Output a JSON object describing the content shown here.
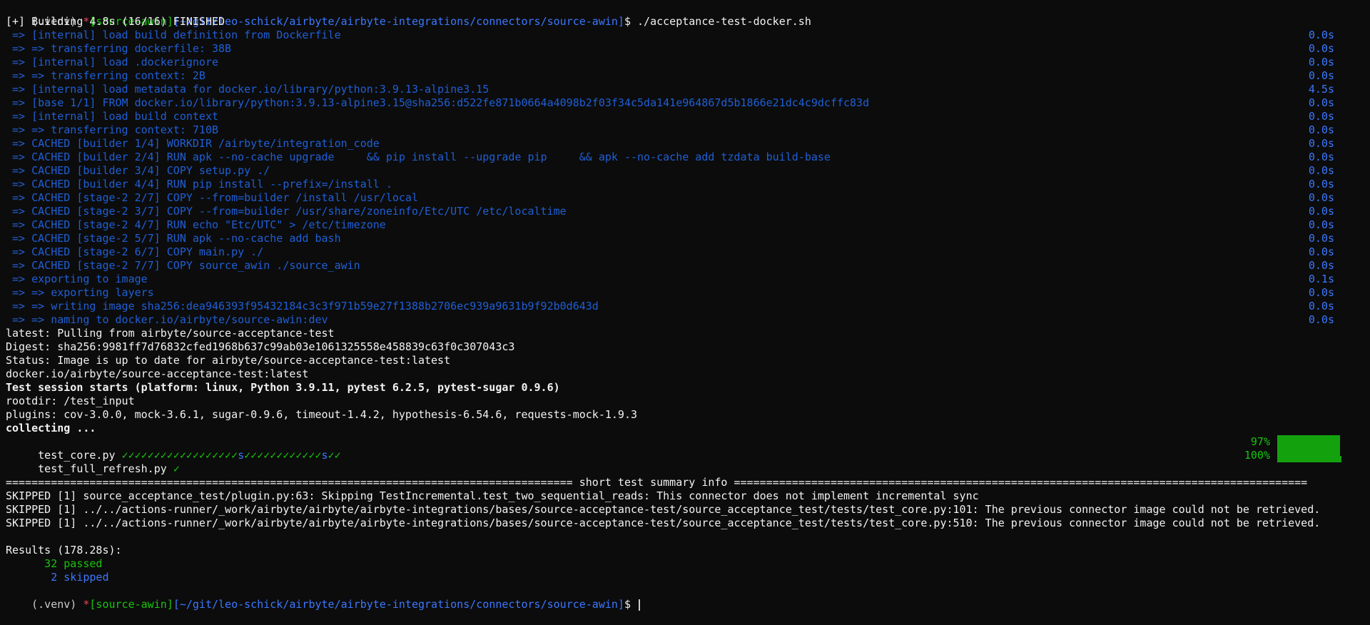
{
  "prompt": {
    "venv": "(.venv) ",
    "star": "*",
    "branch": "[source-awin]",
    "path": "[~/git/leo-schick/airbyte/airbyte-integrations/connectors/source-awin]",
    "dollar": "$ ",
    "command": "./acceptance-test-docker.sh"
  },
  "build_header": "[+] Building 4.8s (16/16) FINISHED",
  "build_steps": [
    {
      "text": " => [internal] load build definition from Dockerfile",
      "time": "0.0s"
    },
    {
      "text": " => => transferring dockerfile: 38B",
      "time": "0.0s"
    },
    {
      "text": " => [internal] load .dockerignore",
      "time": "0.0s"
    },
    {
      "text": " => => transferring context: 2B",
      "time": "0.0s"
    },
    {
      "text": " => [internal] load metadata for docker.io/library/python:3.9.13-alpine3.15",
      "time": "4.5s"
    },
    {
      "text": " => [base 1/1] FROM docker.io/library/python:3.9.13-alpine3.15@sha256:d522fe871b0664a4098b2f03f34c5da141e964867d5b1866e21dc4c9dcffc83d",
      "time": "0.0s"
    },
    {
      "text": " => [internal] load build context",
      "time": "0.0s"
    },
    {
      "text": " => => transferring context: 710B",
      "time": "0.0s"
    },
    {
      "text": " => CACHED [builder 1/4] WORKDIR /airbyte/integration_code",
      "time": "0.0s"
    },
    {
      "text": " => CACHED [builder 2/4] RUN apk --no-cache upgrade     && pip install --upgrade pip     && apk --no-cache add tzdata build-base",
      "time": "0.0s"
    },
    {
      "text": " => CACHED [builder 3/4] COPY setup.py ./",
      "time": "0.0s"
    },
    {
      "text": " => CACHED [builder 4/4] RUN pip install --prefix=/install .",
      "time": "0.0s"
    },
    {
      "text": " => CACHED [stage-2 2/7] COPY --from=builder /install /usr/local",
      "time": "0.0s"
    },
    {
      "text": " => CACHED [stage-2 3/7] COPY --from=builder /usr/share/zoneinfo/Etc/UTC /etc/localtime",
      "time": "0.0s"
    },
    {
      "text": " => CACHED [stage-2 4/7] RUN echo \"Etc/UTC\" > /etc/timezone",
      "time": "0.0s"
    },
    {
      "text": " => CACHED [stage-2 5/7] RUN apk --no-cache add bash",
      "time": "0.0s"
    },
    {
      "text": " => CACHED [stage-2 6/7] COPY main.py ./",
      "time": "0.0s"
    },
    {
      "text": " => CACHED [stage-2 7/7] COPY source_awin ./source_awin",
      "time": "0.0s"
    },
    {
      "text": " => exporting to image",
      "time": "0.1s"
    },
    {
      "text": " => => exporting layers",
      "time": "0.0s"
    },
    {
      "text": " => => writing image sha256:dea946393f95432184c3c3f971b59e27f1388b2706ec939a9631b9f92b0d643d",
      "time": "0.0s"
    },
    {
      "text": " => => naming to docker.io/airbyte/source-awin:dev",
      "time": "0.0s"
    }
  ],
  "pull_lines": [
    "latest: Pulling from airbyte/source-acceptance-test",
    "Digest: sha256:9981ff7d76832cfed1968b637c99ab03e1061325558e458839c63f0c307043c3",
    "Status: Image is up to date for airbyte/source-acceptance-test:latest",
    "docker.io/airbyte/source-acceptance-test:latest"
  ],
  "session_start": "Test session starts (platform: linux, Python 3.9.11, pytest 6.2.5, pytest-sugar 0.9.6)",
  "rootdir": "rootdir: /test_input",
  "plugins": "plugins: cov-3.0.0, mock-3.6.1, sugar-0.9.6, timeout-1.4.2, hypothesis-6.54.6, requests-mock-1.9.3",
  "collecting": "collecting ...",
  "tests": [
    {
      "name": " test_core.py ",
      "marks_a": "✓✓✓✓✓✓✓✓✓✓✓✓✓✓✓✓✓✓",
      "skip_a": "s",
      "marks_b": "✓✓✓✓✓✓✓✓✓✓✓✓",
      "skip_b": "s",
      "marks_c": "✓✓",
      "percent": "97%"
    },
    {
      "name": " test_full_refresh.py ",
      "marks_a": "✓",
      "skip_a": "",
      "marks_b": "",
      "skip_b": "",
      "marks_c": "",
      "percent": "100%"
    }
  ],
  "summary_header": "======================================================================================== short test summary info =========================================================================================",
  "skipped_lines": [
    "SKIPPED [1] source_acceptance_test/plugin.py:63: Skipping TestIncremental.test_two_sequential_reads: This connector does not implement incremental sync",
    "SKIPPED [1] ../../actions-runner/_work/airbyte/airbyte/airbyte-integrations/bases/source-acceptance-test/source_acceptance_test/tests/test_core.py:101: The previous connector image could not be retrieved.",
    "SKIPPED [1] ../../actions-runner/_work/airbyte/airbyte/airbyte-integrations/bases/source-acceptance-test/source_acceptance_test/tests/test_core.py:510: The previous connector image could not be retrieved."
  ],
  "results_header": "Results (178.28s):",
  "passed": "      32 passed",
  "skipped": "       2 skipped",
  "colors": {
    "background": "#0c0c0c",
    "text": "#cccccc",
    "blue": "#3b78ff",
    "green": "#16c60c",
    "red": "#e74856"
  }
}
